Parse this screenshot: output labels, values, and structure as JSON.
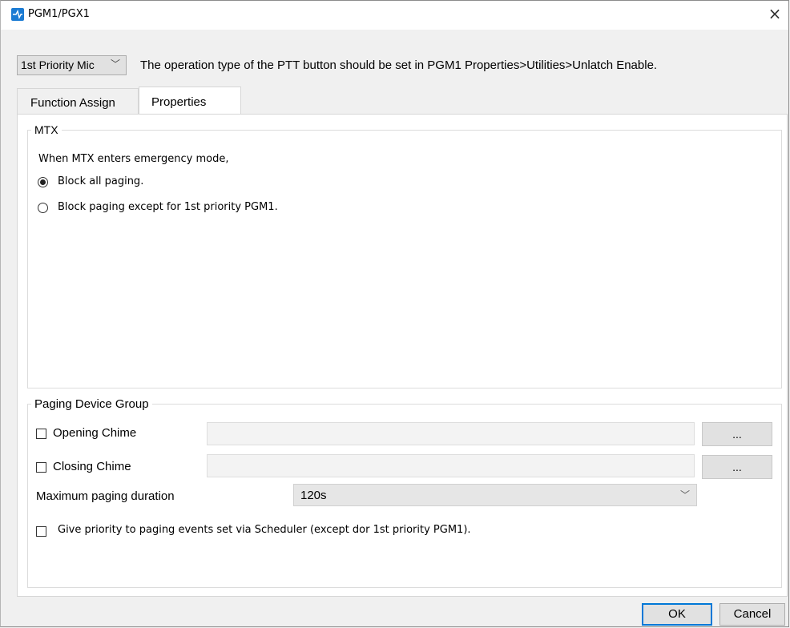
{
  "window": {
    "title": "PGM1/PGX1",
    "close_glyph": "×",
    "icon": "app-icon"
  },
  "header": {
    "mic_select": {
      "value": "1st Priority Mic",
      "chevron": "﹀"
    },
    "notice": "The operation type of the PTT button should be set in PGM1 Properties>Utilities>Unlatch Enable."
  },
  "tabs": [
    {
      "label": "Function Assign",
      "active": false
    },
    {
      "label": "Properties",
      "active": true
    }
  ],
  "mtx": {
    "legend": "MTX",
    "intro": "When MTX enters emergency mode,",
    "options": [
      {
        "label": "Block all paging.",
        "checked": true
      },
      {
        "label": "Block paging except for 1st priority PGM1.",
        "checked": false
      }
    ]
  },
  "paging": {
    "legend": "Paging Device Group",
    "opening": {
      "label": "Opening Chime",
      "checked": false,
      "value": "",
      "browse": "..."
    },
    "closing": {
      "label": "Closing Chime",
      "checked": false,
      "value": "",
      "browse": "..."
    },
    "duration": {
      "label": "Maximum paging duration",
      "value": "120s",
      "chevron": "﹀"
    },
    "scheduler": {
      "label": "Give priority to paging events set via Scheduler (except dor 1st priority PGM1).",
      "checked": false
    }
  },
  "footer": {
    "ok": "OK",
    "cancel": "Cancel"
  },
  "colors": {
    "accent": "#0078d7",
    "icon": "#1b7bd3"
  }
}
